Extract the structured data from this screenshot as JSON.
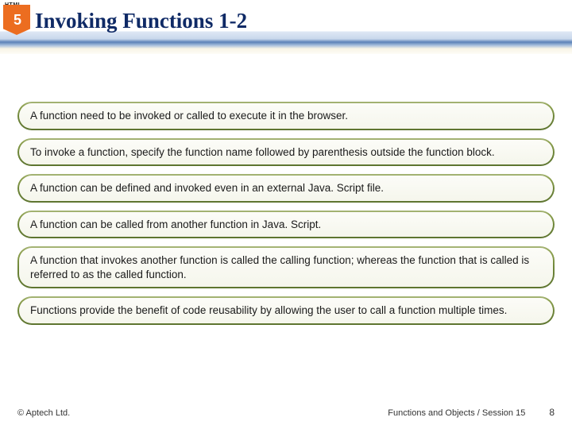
{
  "header": {
    "logo_label": "HTML",
    "logo_number": "5",
    "title": "Invoking Functions 1-2"
  },
  "bullets": [
    "A function need to be invoked or called to execute it in the browser.",
    "To invoke a function, specify the function name followed by parenthesis outside the function block.",
    "A function can be defined and invoked even in an external Java. Script file.",
    "A function can be called from another function in Java. Script.",
    "A function that invokes another function is called the calling function; whereas the function that is called is referred to as the called function.",
    "Functions provide the benefit of code reusability by allowing the user to call a function multiple times."
  ],
  "footer": {
    "copyright": "© Aptech Ltd.",
    "session": "Functions and Objects / Session 15",
    "page": "8"
  }
}
